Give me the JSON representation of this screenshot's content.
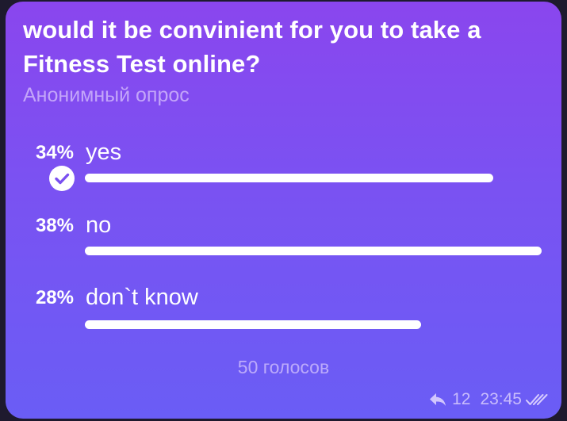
{
  "poll": {
    "question": "would it be convinient for you to take a Fitness Test online?",
    "type_label": "Анонимный опрос",
    "options": [
      {
        "percent_label": "34%",
        "text": "yes",
        "share": 0.34,
        "selected": true
      },
      {
        "percent_label": "38%",
        "text": "no",
        "share": 0.38,
        "selected": false
      },
      {
        "percent_label": "28%",
        "text": "don`t know",
        "share": 0.28,
        "selected": false
      }
    ],
    "votes_label": "50 голосов"
  },
  "meta": {
    "replies": "12",
    "time": "23:45",
    "reply_icon": "reply-arrow-icon",
    "status_icon": "double-check-icon",
    "selected_icon": "check-circle-icon"
  },
  "colors": {
    "gradient_top": "#8a46ee",
    "gradient_bottom": "#6a5df5",
    "bar": "#ffffff",
    "muted_text": "#e2d6ff"
  }
}
